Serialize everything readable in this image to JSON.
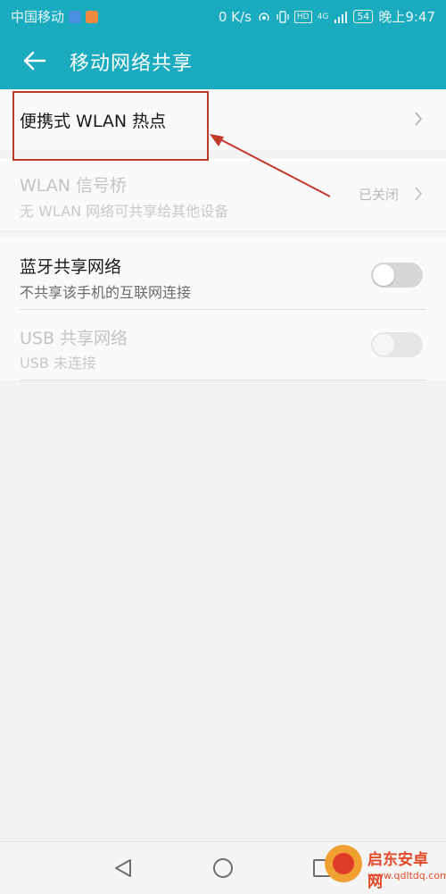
{
  "status_bar": {
    "carrier": "中国移动",
    "speed": "0 K/s",
    "network_badge": "HD",
    "signal": "4G",
    "battery": "54",
    "time": "晚上9:47"
  },
  "app_bar": {
    "title": "移动网络共享",
    "back_icon": "arrow-left-icon"
  },
  "items": {
    "hotspot": {
      "title": "便携式 WLAN 热点"
    },
    "wlan_bridge": {
      "title": "WLAN 信号桥",
      "subtitle": "无 WLAN 网络可共享给其他设备",
      "status": "已关闭"
    },
    "bluetooth": {
      "title": "蓝牙共享网络",
      "subtitle": "不共享该手机的互联网连接",
      "enabled": false
    },
    "usb": {
      "title": "USB 共享网络",
      "subtitle": "USB 未连接",
      "enabled": false
    }
  },
  "nav": {
    "back_icon": "triangle-back-icon",
    "home_icon": "circle-home-icon",
    "recents_icon": "square-recents-icon"
  },
  "watermark": {
    "name": "启东安卓网",
    "url": "www.qdltdq.com"
  },
  "colors": {
    "accent": "#1aabbf",
    "highlight": "#c0392b"
  }
}
